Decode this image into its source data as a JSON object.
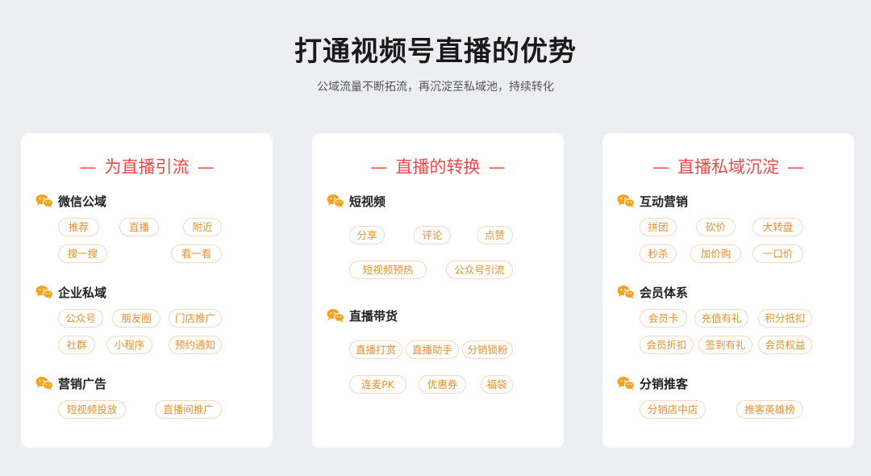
{
  "header": {
    "title": "打通视频号直播的优势",
    "subtitle": "公域流量不断拓流，再沉淀至私域池，持续转化"
  },
  "colors": {
    "accent": "#f04848",
    "tag_text": "#e8902e",
    "icon": "#f7a21b"
  },
  "icon_name": "wechat-icon",
  "cards": [
    {
      "title": "为直播引流",
      "dash": "—",
      "sections": [
        {
          "name": "微信公域",
          "tags": [
            "推荐",
            "直播",
            "附近",
            "搜一搜",
            "看一看"
          ]
        },
        {
          "name": "企业私域",
          "tags": [
            "公众号",
            "朋友圈",
            "门店推广",
            "社群",
            "小程序",
            "预约通知"
          ]
        },
        {
          "name": "营销广告",
          "tags": [
            "短视频投放",
            "直播间推广"
          ]
        }
      ]
    },
    {
      "title": "直播的转换",
      "dash": "—",
      "sections": [
        {
          "name": "短视频",
          "tags": [
            "分享",
            "评论",
            "点赞",
            "短视频预热",
            "公众号引流"
          ]
        },
        {
          "name": "直播带货",
          "tags": [
            "直播打赏",
            "直播助手",
            "分销锁粉",
            "连麦PK",
            "优惠券",
            "福袋"
          ]
        }
      ]
    },
    {
      "title": "直播私域沉淀",
      "dash": "—",
      "sections": [
        {
          "name": "互动营销",
          "tags": [
            "拼团",
            "砍价",
            "大转盘",
            "秒杀",
            "加价购",
            "一口价"
          ]
        },
        {
          "name": "会员体系",
          "tags": [
            "会员卡",
            "充值有礼",
            "积分抵扣",
            "会员折扣",
            "签到有礼",
            "会员权益"
          ]
        },
        {
          "name": "分销推客",
          "tags": [
            "分销店中店",
            "推客英雄榜"
          ]
        }
      ]
    }
  ]
}
